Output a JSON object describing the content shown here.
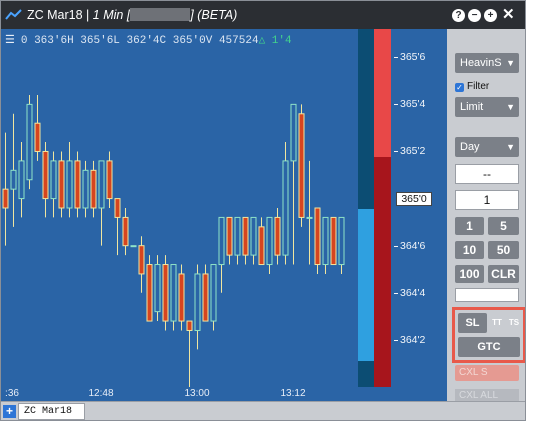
{
  "window": {
    "title_symbol": "ZC Mar18",
    "title_interval": "1 Min [",
    "title_suffix": "] (BETA)",
    "buttons": [
      "?",
      "−",
      "+",
      "✕"
    ]
  },
  "chart": {
    "quote": {
      "o": "0 363'6H",
      "h": "365'6L",
      "l": "362'4C",
      "c": "365'0V",
      "v": "457524",
      "chg": "1'4"
    },
    "time_labels": [
      ":36",
      "12:48",
      "13:00",
      "13:12"
    ],
    "bars": [
      {
        "t": 0,
        "o": 3650.5,
        "h": 3653.5,
        "l": 3647.5,
        "c": 3649.5
      },
      {
        "t": 1,
        "o": 3650.5,
        "h": 3654.5,
        "l": 3648.5,
        "c": 3651.5
      },
      {
        "t": 2,
        "o": 3650.0,
        "h": 3653.0,
        "l": 3649.0,
        "c": 3652.0
      },
      {
        "t": 3,
        "o": 3651.0,
        "h": 3655.5,
        "l": 3650.5,
        "c": 3655.0
      },
      {
        "t": 4,
        "o": 3654.0,
        "h": 3655.5,
        "l": 3652.0,
        "c": 3652.5
      },
      {
        "t": 5,
        "o": 3652.5,
        "h": 3653.0,
        "l": 3649.0,
        "c": 3650.0
      },
      {
        "t": 6,
        "o": 3650.0,
        "h": 3652.5,
        "l": 3649.0,
        "c": 3652.0
      },
      {
        "t": 7,
        "o": 3652.0,
        "h": 3652.5,
        "l": 3649.0,
        "c": 3649.5
      },
      {
        "t": 8,
        "o": 3649.5,
        "h": 3653.0,
        "l": 3649.0,
        "c": 3652.0
      },
      {
        "t": 9,
        "o": 3652.0,
        "h": 3652.5,
        "l": 3649.0,
        "c": 3649.5
      },
      {
        "t": 10,
        "o": 3649.5,
        "h": 3652.0,
        "l": 3649.0,
        "c": 3651.5
      },
      {
        "t": 11,
        "o": 3651.5,
        "h": 3652.0,
        "l": 3649.0,
        "c": 3649.5
      },
      {
        "t": 12,
        "o": 3649.5,
        "h": 3652.0,
        "l": 3647.5,
        "c": 3652.0
      },
      {
        "t": 13,
        "o": 3652.0,
        "h": 3652.5,
        "l": 3649.5,
        "c": 3650.0
      },
      {
        "t": 14,
        "o": 3650.0,
        "h": 3650.0,
        "l": 3647.0,
        "c": 3649.0
      },
      {
        "t": 15,
        "o": 3649.0,
        "h": 3649.5,
        "l": 3647.0,
        "c": 3647.5
      },
      {
        "t": 16,
        "o": 3647.5,
        "h": 3647.5,
        "l": 3647.5,
        "c": 3647.5
      },
      {
        "t": 17,
        "o": 3647.5,
        "h": 3648.0,
        "l": 3645.0,
        "c": 3646.0
      },
      {
        "t": 18,
        "o": 3646.5,
        "h": 3647.0,
        "l": 3643.5,
        "c": 3643.5
      },
      {
        "t": 19,
        "o": 3644.0,
        "h": 3647.0,
        "l": 3643.5,
        "c": 3646.5
      },
      {
        "t": 20,
        "o": 3646.5,
        "h": 3647.0,
        "l": 3643.0,
        "c": 3643.5
      },
      {
        "t": 21,
        "o": 3643.5,
        "h": 3646.5,
        "l": 3643.0,
        "c": 3646.5
      },
      {
        "t": 22,
        "o": 3646.0,
        "h": 3646.5,
        "l": 3643.0,
        "c": 3643.5
      },
      {
        "t": 23,
        "o": 3643.5,
        "h": 3643.5,
        "l": 3640.0,
        "c": 3643.0
      },
      {
        "t": 24,
        "o": 3643.0,
        "h": 3646.5,
        "l": 3642.0,
        "c": 3646.0
      },
      {
        "t": 25,
        "o": 3646.0,
        "h": 3646.5,
        "l": 3643.5,
        "c": 3643.5
      },
      {
        "t": 26,
        "o": 3643.5,
        "h": 3646.5,
        "l": 3643.0,
        "c": 3646.5
      },
      {
        "t": 27,
        "o": 3646.5,
        "h": 3649.0,
        "l": 3645.0,
        "c": 3649.0
      },
      {
        "t": 28,
        "o": 3649.0,
        "h": 3649.0,
        "l": 3646.5,
        "c": 3647.0
      },
      {
        "t": 29,
        "o": 3647.0,
        "h": 3649.0,
        "l": 3646.5,
        "c": 3649.0
      },
      {
        "t": 30,
        "o": 3649.0,
        "h": 3649.0,
        "l": 3646.5,
        "c": 3647.0
      },
      {
        "t": 31,
        "o": 3647.0,
        "h": 3649.0,
        "l": 3646.5,
        "c": 3649.0
      },
      {
        "t": 32,
        "o": 3648.5,
        "h": 3649.0,
        "l": 3646.5,
        "c": 3646.5
      },
      {
        "t": 33,
        "o": 3646.5,
        "h": 3649.0,
        "l": 3646.0,
        "c": 3649.0
      },
      {
        "t": 34,
        "o": 3649.0,
        "h": 3649.5,
        "l": 3646.5,
        "c": 3647.0
      },
      {
        "t": 35,
        "o": 3647.0,
        "h": 3653.0,
        "l": 3646.5,
        "c": 3652.0
      },
      {
        "t": 36,
        "o": 3652.0,
        "h": 3655.0,
        "l": 3646.5,
        "c": 3655.0
      },
      {
        "t": 37,
        "o": 3654.5,
        "h": 3655.0,
        "l": 3648.5,
        "c": 3649.0
      },
      {
        "t": 38,
        "o": 3649.0,
        "h": 3652.0,
        "l": 3646.5,
        "c": 3649.0
      },
      {
        "t": 39,
        "o": 3649.5,
        "h": 3649.5,
        "l": 3646.0,
        "c": 3646.5
      },
      {
        "t": 40,
        "o": 3646.5,
        "h": 3649.0,
        "l": 3646.0,
        "c": 3649.0
      },
      {
        "t": 41,
        "o": 3649.0,
        "h": 3649.0,
        "l": 3646.5,
        "c": 3646.5
      },
      {
        "t": 42,
        "o": 3646.5,
        "h": 3649.0,
        "l": 3646.0,
        "c": 3649.0
      }
    ],
    "price_min": 3640.0,
    "price_max": 3659.0
  },
  "ladder": {
    "price_labels": [
      {
        "label": "365'6",
        "value": 3657.5
      },
      {
        "label": "365'4",
        "value": 3655.0
      },
      {
        "label": "365'2",
        "value": 3652.5
      },
      {
        "label": "364'6",
        "value": 3647.5
      },
      {
        "label": "364'4",
        "value": 3645.0
      },
      {
        "label": "364'2",
        "value": 3642.5
      }
    ],
    "last_price": {
      "label": "365'0",
      "value": 3650.0
    },
    "colors": {
      "ask_light": "#e84848",
      "ask_dark": "#a7151c",
      "bid_light": "#2fa0e0",
      "bid_dark": "#0c4d73",
      "bg": "#2a64a6"
    }
  },
  "panel": {
    "account": "HeavinS",
    "filter_label": "Filter",
    "filter_checked": true,
    "order_type": "Limit",
    "duration": "Day",
    "price_field": "--",
    "qty_field": "1",
    "qty_buttons": [
      "1",
      "5",
      "10",
      "50",
      "100",
      "CLR"
    ],
    "sl_label": "SL",
    "tt_label": "TT",
    "ts_label": "TS",
    "gtc_label": "GTC",
    "cxl_s_label": "CXL  S",
    "cxl_all_label": "CXL  ALL"
  },
  "tabs": {
    "add_label": "+",
    "active": "ZC Mar18"
  },
  "colors": {
    "accent": "#2d75d6",
    "chart_bg": "#2a64a6",
    "highlight": "#e8594a",
    "up_bar": "#8fe3c8",
    "down_bar": "#d6451f",
    "wick": "#f0e6a0"
  }
}
